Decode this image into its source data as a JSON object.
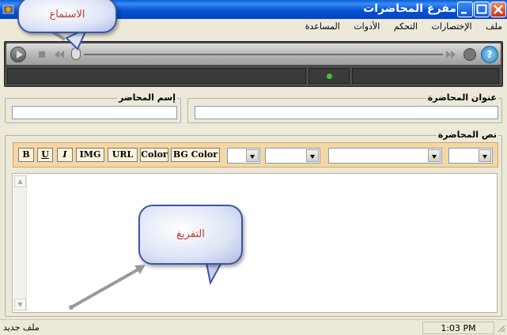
{
  "window": {
    "title": "مفرغ المحاضرات"
  },
  "menu": [
    "ملف",
    "الإختصارات",
    "التحكم",
    "الأدوات",
    "المساعدة"
  ],
  "player": {
    "controls": [
      "play",
      "stop",
      "rewind",
      "fast-forward",
      "volume"
    ]
  },
  "form": {
    "lecture_title_label": "عنوان المحاضرة",
    "lecture_title_value": "",
    "lecturer_name_label": "إسم المحاضر",
    "lecturer_name_value": "",
    "lecture_text_label": "نص المحاضرة"
  },
  "format_toolbar": {
    "buttons": [
      "B",
      "U",
      "I",
      "IMG",
      "URL",
      "Color",
      "BG Color"
    ]
  },
  "editor": {
    "content": ""
  },
  "status": {
    "left": "ملف جديد",
    "time": "1:03 PM"
  },
  "callouts": {
    "listening": "الاستماع",
    "transcription": "التفريغ"
  }
}
